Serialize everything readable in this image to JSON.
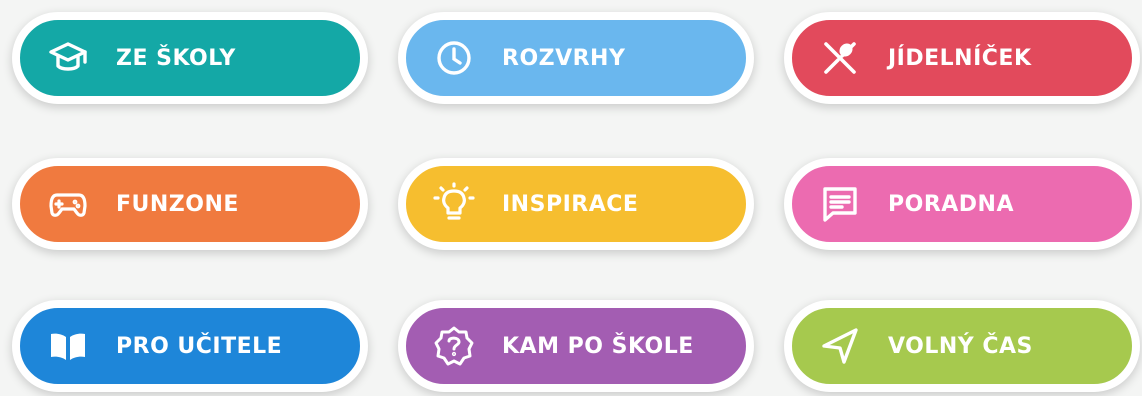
{
  "colors": {
    "teal": "#14a8a6",
    "sky": "#6ab7ee",
    "red": "#e24a5c",
    "orange": "#f07a3f",
    "yellow": "#f6be2f",
    "pink": "#ec6bb0",
    "blue": "#1e86d9",
    "purple": "#a35db2",
    "green": "#a6c94e"
  },
  "menu": {
    "items": [
      {
        "label": "ZE ŠKOLY",
        "icon": "graduation-cap-icon"
      },
      {
        "label": "ROZVRHY",
        "icon": "clock-icon"
      },
      {
        "label": "JÍDELNÍČEK",
        "icon": "fork-knife-icon"
      },
      {
        "label": "FUNZONE",
        "icon": "gamepad-icon"
      },
      {
        "label": "INSPIRACE",
        "icon": "lightbulb-icon"
      },
      {
        "label": "PORADNA",
        "icon": "chat-bubble-icon"
      },
      {
        "label": "PRO UČITELE",
        "icon": "open-book-icon"
      },
      {
        "label": "KAM PO ŠKOLE",
        "icon": "question-badge-icon"
      },
      {
        "label": "VOLNÝ ČAS",
        "icon": "navigation-arrow-icon"
      }
    ]
  }
}
